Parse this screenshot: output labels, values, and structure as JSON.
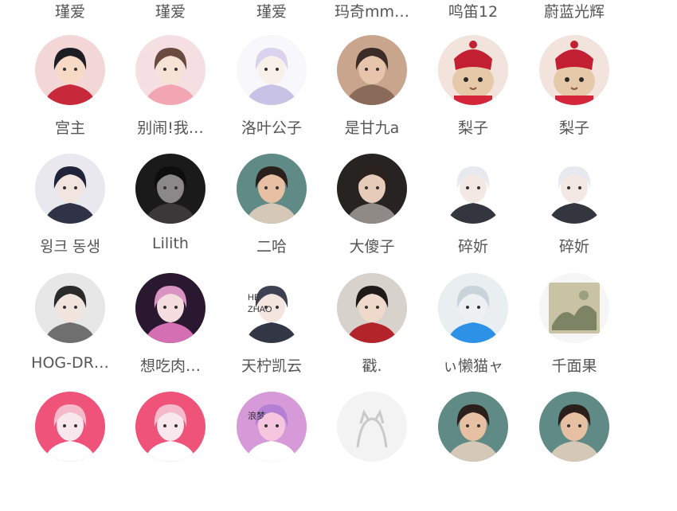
{
  "rows": [
    {
      "labels_only": true,
      "items": [
        {
          "name": "瑾爱",
          "avatar_icon": "anime-avatar-icon"
        },
        {
          "name": "瑾爱",
          "avatar_icon": "anime-avatar-icon"
        },
        {
          "name": "瑾爱",
          "avatar_icon": "anime-avatar-icon"
        },
        {
          "name": "玛奇mm…",
          "avatar_icon": "photo-avatar-icon"
        },
        {
          "name": "鸣笛12",
          "avatar_icon": "photo-avatar-icon"
        },
        {
          "name": "蔚蓝光辉",
          "avatar_icon": "photo-avatar-icon"
        }
      ]
    },
    {
      "items": [
        {
          "name": "宫主",
          "avatar_icon": "anime-boy-red-avatar-icon",
          "bg": "#f3d6d6",
          "fg": "#c8293a",
          "skin": "#f6dac5",
          "hair": "#1d1d24"
        },
        {
          "name": "别闹!我…",
          "avatar_icon": "anime-girl-flower-avatar-icon",
          "bg": "#f6dfe3",
          "fg": "#f2a6b4",
          "skin": "#f7e2d6",
          "hair": "#6b4a3f"
        },
        {
          "name": "洛叶公子",
          "avatar_icon": "sketch-girl-avatar-icon",
          "bg": "#f8f7fb",
          "fg": "#c7c2e6",
          "skin": "#f7f1ea",
          "hair": "#d9d3ee"
        },
        {
          "name": "是甘九a",
          "avatar_icon": "photo-girl-avatar-icon",
          "bg": "#c9a58d",
          "fg": "#8a6a58",
          "skin": "#e7c5ad",
          "hair": "#3b2c27"
        },
        {
          "name": "梨子",
          "avatar_icon": "cat-red-hat-avatar-icon",
          "bg": "#f2e4dc",
          "fg": "#d4263a",
          "skin": "#e6c9a8",
          "hair": "#c21f32"
        },
        {
          "name": "梨子",
          "avatar_icon": "cat-red-hat-avatar-icon",
          "bg": "#f2e4dc",
          "fg": "#d4263a",
          "skin": "#e6c9a8",
          "hair": "#c21f32"
        }
      ]
    },
    {
      "items": [
        {
          "name": "윙크 동생",
          "avatar_icon": "anime-boy-dark-avatar-icon",
          "bg": "#e9e8ee",
          "fg": "#2f3345",
          "skin": "#f2e5df",
          "hair": "#20233a"
        },
        {
          "name": "Lilith",
          "avatar_icon": "dark-ghost-avatar-icon",
          "bg": "#1b1a1a",
          "fg": "#3a3838",
          "skin": "#8a8888",
          "hair": "#0e0e0e"
        },
        {
          "name": "二哈",
          "avatar_icon": "photo-boy-avatar-icon",
          "bg": "#5f8a86",
          "fg": "#d6c8b7",
          "skin": "#e7bfa2",
          "hair": "#2a1f1a"
        },
        {
          "name": "大傻子",
          "avatar_icon": "photo-girl-dark-avatar-icon",
          "bg": "#262322",
          "fg": "#8f8a86",
          "skin": "#e6cbb8",
          "hair": "#2b211d"
        },
        {
          "name": "碎妡",
          "avatar_icon": "anime-girl-white-avatar-icon",
          "bg": "#ffffff",
          "fg": "#34363f",
          "skin": "#f4e8e4",
          "hair": "#e7e9ee"
        },
        {
          "name": "碎妡",
          "avatar_icon": "anime-girl-white-avatar-icon",
          "bg": "#ffffff",
          "fg": "#34363f",
          "skin": "#f4e8e4",
          "hair": "#e7e9ee"
        }
      ]
    },
    {
      "items": [
        {
          "name": "HOG-DR…",
          "avatar_icon": "anime-boy-suit-avatar-icon",
          "bg": "#e7e7e7",
          "fg": "#6f6f6f",
          "skin": "#f1e4dc",
          "hair": "#2a2a2a"
        },
        {
          "name": "想吃肉…",
          "avatar_icon": "anime-girl-pink-avatar-icon",
          "bg": "#2a1830",
          "fg": "#d46fb1",
          "skin": "#f6dde0",
          "hair": "#d994c4"
        },
        {
          "name": "天柠凯云",
          "avatar_icon": "anime-boy-he-zhao-avatar-icon",
          "bg": "#ffffff",
          "fg": "#333644",
          "skin": "#f4e6df",
          "hair": "#3e4152",
          "caption": "HE\nZHAO"
        },
        {
          "name": "戳.",
          "avatar_icon": "anime-boy-blood-avatar-icon",
          "bg": "#d8d2cc",
          "fg": "#b3242a",
          "skin": "#efd9cb",
          "hair": "#1f1a17"
        },
        {
          "name": "ぃ懒猫ャ",
          "avatar_icon": "anime-blue-band-avatar-icon",
          "bg": "#e9eef1",
          "fg": "#2d92e6",
          "skin": "#eef1f4",
          "hair": "#c9d3da"
        },
        {
          "name": "千面果",
          "avatar_icon": "painting-avatar-icon",
          "bg": "#f6f6f6",
          "fg": "#7a8a6a",
          "skin": "#c9c2a3",
          "hair": "#5c6a4a"
        }
      ]
    },
    {
      "partial": true,
      "items": [
        {
          "name": "",
          "avatar_icon": "anime-boy-pink-avatar-icon",
          "bg": "#f0537a",
          "fg": "#ffffff",
          "skin": "#f8e8ee",
          "hair": "#f6b9c9"
        },
        {
          "name": "",
          "avatar_icon": "anime-boy-pink-avatar-icon",
          "bg": "#f0537a",
          "fg": "#ffffff",
          "skin": "#f8e8ee",
          "hair": "#f6b9c9"
        },
        {
          "name": "",
          "avatar_icon": "pink-sky-text-avatar-icon",
          "bg": "#d79ad8",
          "fg": "#ffffff",
          "skin": "#f5c6dd",
          "hair": "#b57fd6",
          "caption": "浪梦"
        },
        {
          "name": "",
          "avatar_icon": "outline-cat-avatar-icon",
          "bg": "#f3f3f3",
          "fg": "#c9c9c9",
          "skin": "#ffffff",
          "hair": "#d0d0d0"
        },
        {
          "name": "",
          "avatar_icon": "photo-boy-avatar-icon",
          "bg": "#5f8a86",
          "fg": "#d6c8b7",
          "skin": "#e7bfa2",
          "hair": "#2a1f1a"
        },
        {
          "name": "",
          "avatar_icon": "photo-boy-avatar-icon",
          "bg": "#5f8a86",
          "fg": "#d6c8b7",
          "skin": "#e7bfa2",
          "hair": "#2a1f1a"
        }
      ]
    }
  ],
  "colors": {
    "label": "#555555",
    "background": "#ffffff"
  }
}
